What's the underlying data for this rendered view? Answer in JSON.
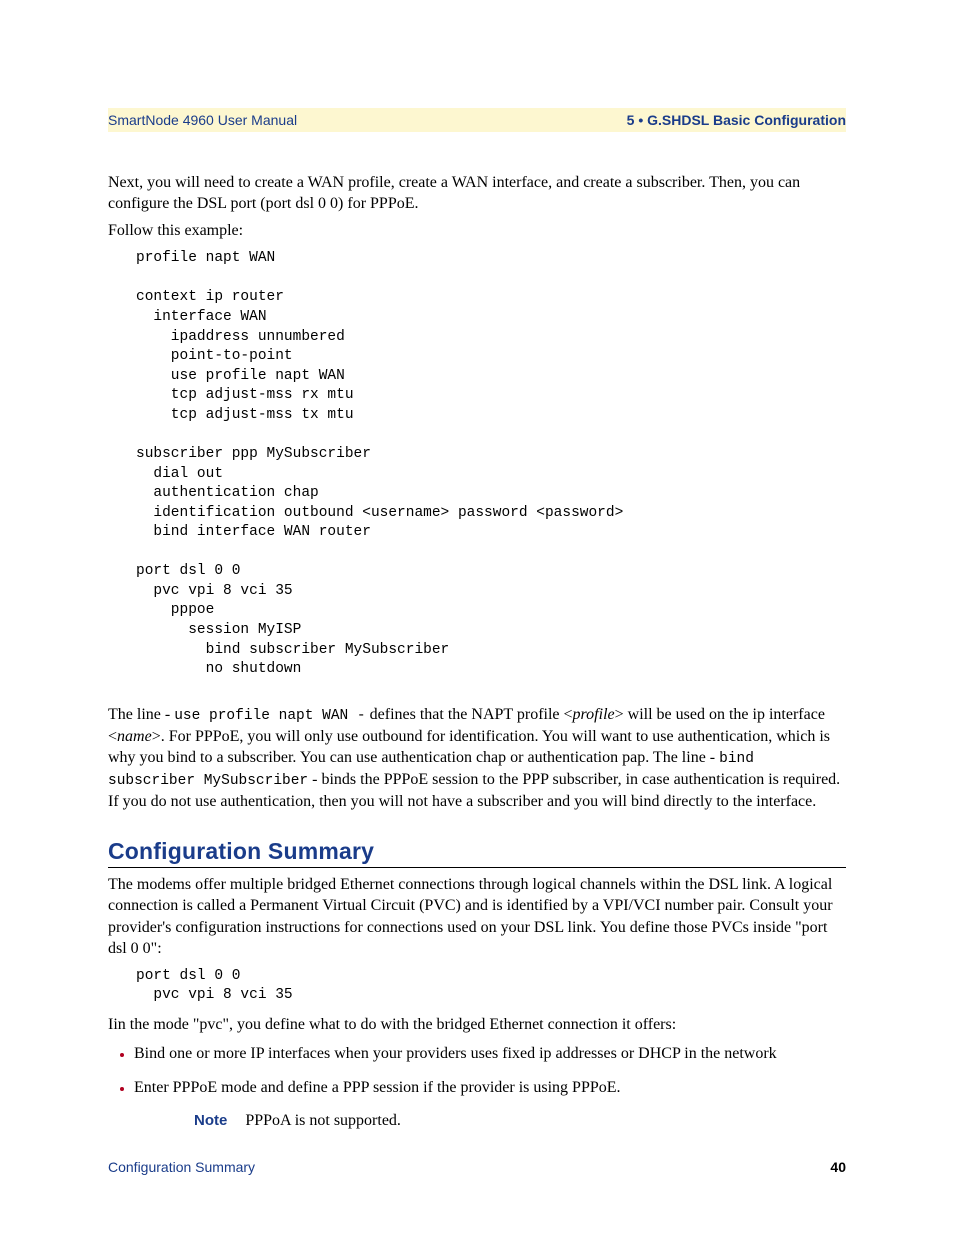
{
  "header": {
    "left": "SmartNode 4960 User Manual",
    "right": "5 • G.SHDSL Basic Configuration"
  },
  "intro": {
    "p1": "Next, you will need to create a WAN profile, create a WAN interface, and create a subscriber. Then, you can configure the DSL port (port dsl 0 0) for PPPoE.",
    "p2": "Follow this example:"
  },
  "code1": "profile napt WAN\n\ncontext ip router\n  interface WAN\n    ipaddress unnumbered\n    point-to-point\n    use profile napt WAN\n    tcp adjust-mss rx mtu\n    tcp adjust-mss tx mtu\n\nsubscriber ppp MySubscriber\n  dial out\n  authentication chap\n  identification outbound <username> password <password>\n  bind interface WAN router\n\nport dsl 0 0\n  pvc vpi 8 vci 35\n    pppoe\n      session MyISP\n        bind subscriber MySubscriber\n        no shutdown",
  "explain": {
    "pre": "The line - ",
    "code1": "use profile napt WAN -",
    "mid1": " defines that the NAPT profile <",
    "ital1": "profile",
    "mid2": "> will be used on the ip interface <",
    "ital2": "name",
    "mid3": ">. For PPPoE, you will only use outbound for identification. You will want to use authentication, which is why you bind to a subscriber. You can use authentication chap or authentication pap. The line - ",
    "code2": "bind subscriber MySubscriber",
    "mid4": " - binds the PPPoE session to the PPP subscriber, in case authentication is required. If you do not use authentication, then you will not have a subscriber and you will bind directly to the interface."
  },
  "section": {
    "title": "Configuration Summary",
    "p1": "The modems offer multiple bridged Ethernet connections through logical channels within the DSL link. A logical connection is called a Permanent Virtual Circuit (PVC) and is identified by a VPI/VCI number pair. Consult your provider's configuration instructions for connections used on your DSL link. You define those PVCs inside \"port dsl 0 0\":"
  },
  "code2": "port dsl 0 0\n  pvc vpi 8 vci 35",
  "p_after_code2": "Iin the mode \"pvc\", you define what to do with the bridged Ethernet connection it offers:",
  "bullets": [
    "Bind one or more IP interfaces when your providers uses fixed ip addresses or DHCP in the network",
    "Enter PPPoE mode and define a PPP session if the provider is using PPPoE."
  ],
  "note": {
    "label": "Note",
    "text": "PPPoA is not supported."
  },
  "footer": {
    "left": "Configuration Summary",
    "right": "40"
  }
}
